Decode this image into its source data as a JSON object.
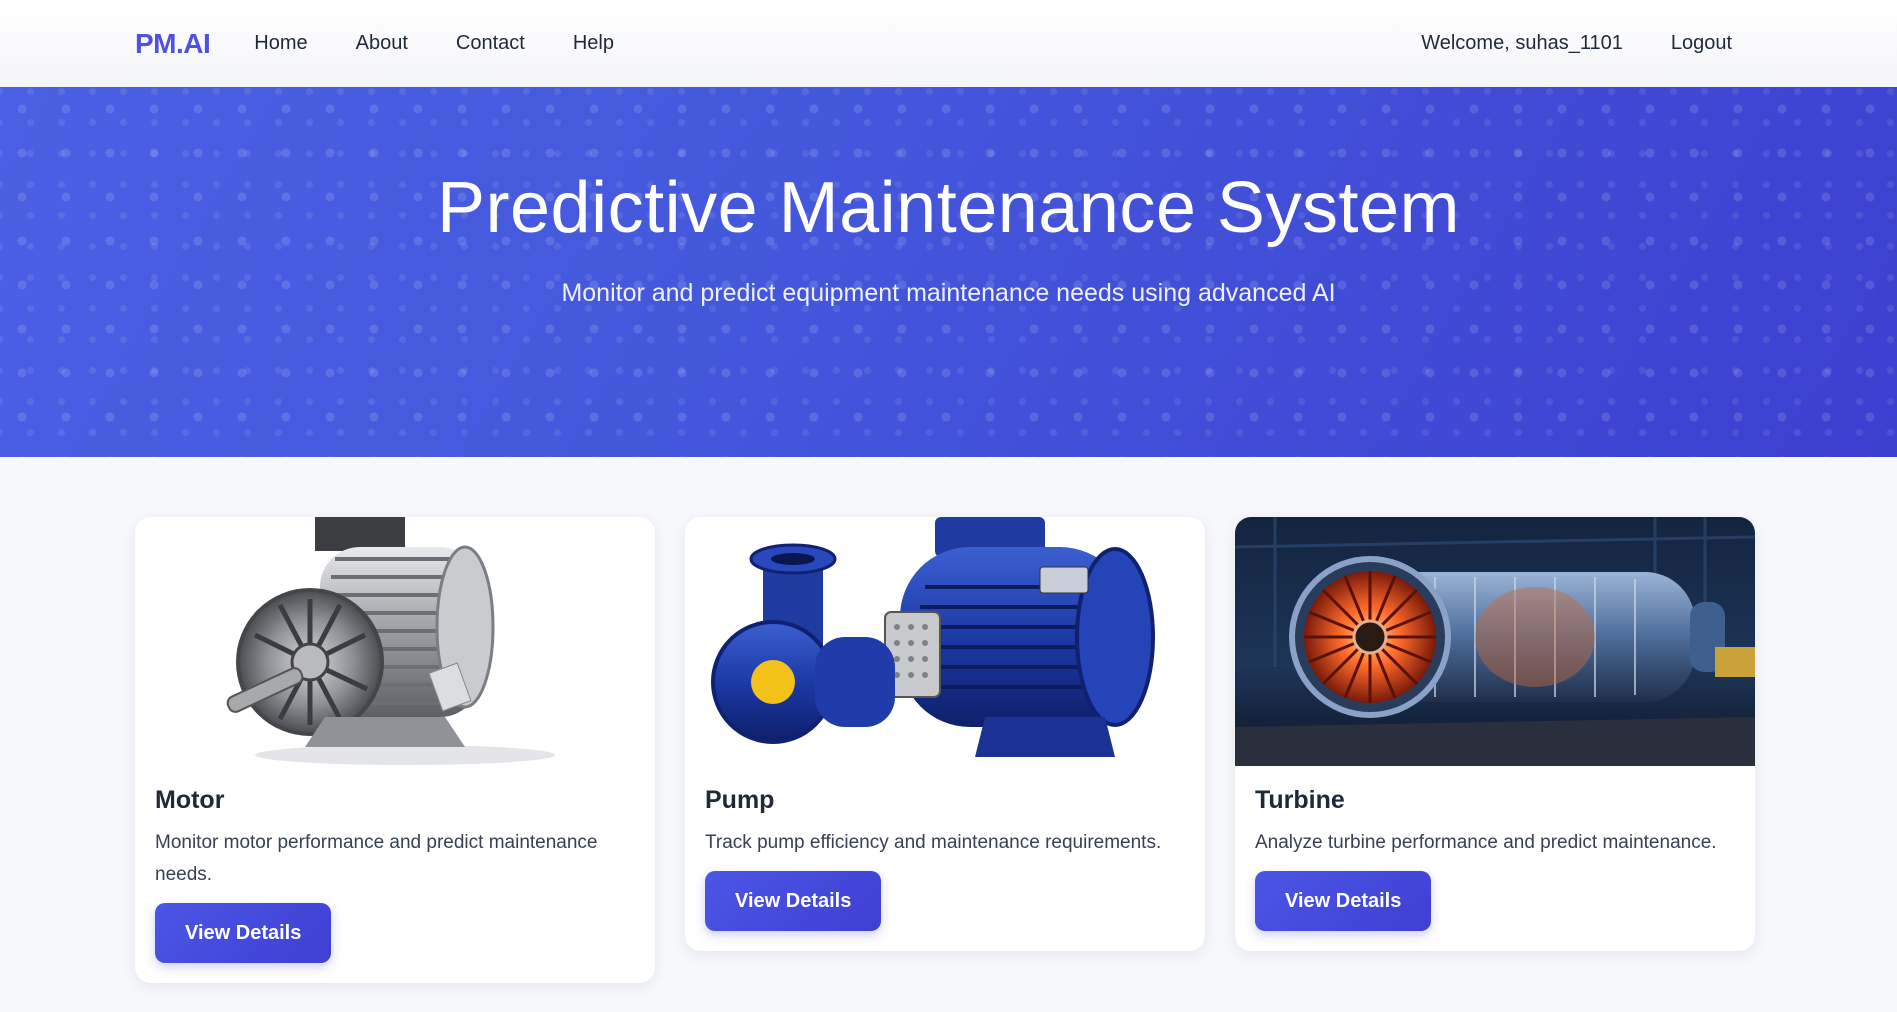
{
  "navbar": {
    "brand": "PM.AI",
    "links": [
      "Home",
      "About",
      "Contact",
      "Help"
    ],
    "welcome": "Welcome, suhas_1101",
    "logout": "Logout"
  },
  "hero": {
    "title": "Predictive Maintenance System",
    "subtitle": "Monitor and predict equipment maintenance needs using advanced AI"
  },
  "cards": [
    {
      "title": "Motor",
      "description": "Monitor motor performance and predict maintenance needs.",
      "button": "View Details",
      "image": "electric-motor"
    },
    {
      "title": "Pump",
      "description": "Track pump efficiency and maintenance requirements.",
      "button": "View Details",
      "image": "centrifugal-pump"
    },
    {
      "title": "Turbine",
      "description": "Analyze turbine performance and predict maintenance.",
      "button": "View Details",
      "image": "gas-turbine"
    }
  ],
  "colors": {
    "brand": "#4f52e0",
    "hero": "#4458dc",
    "button": "#4349dd",
    "background": "#f6f8fb"
  }
}
